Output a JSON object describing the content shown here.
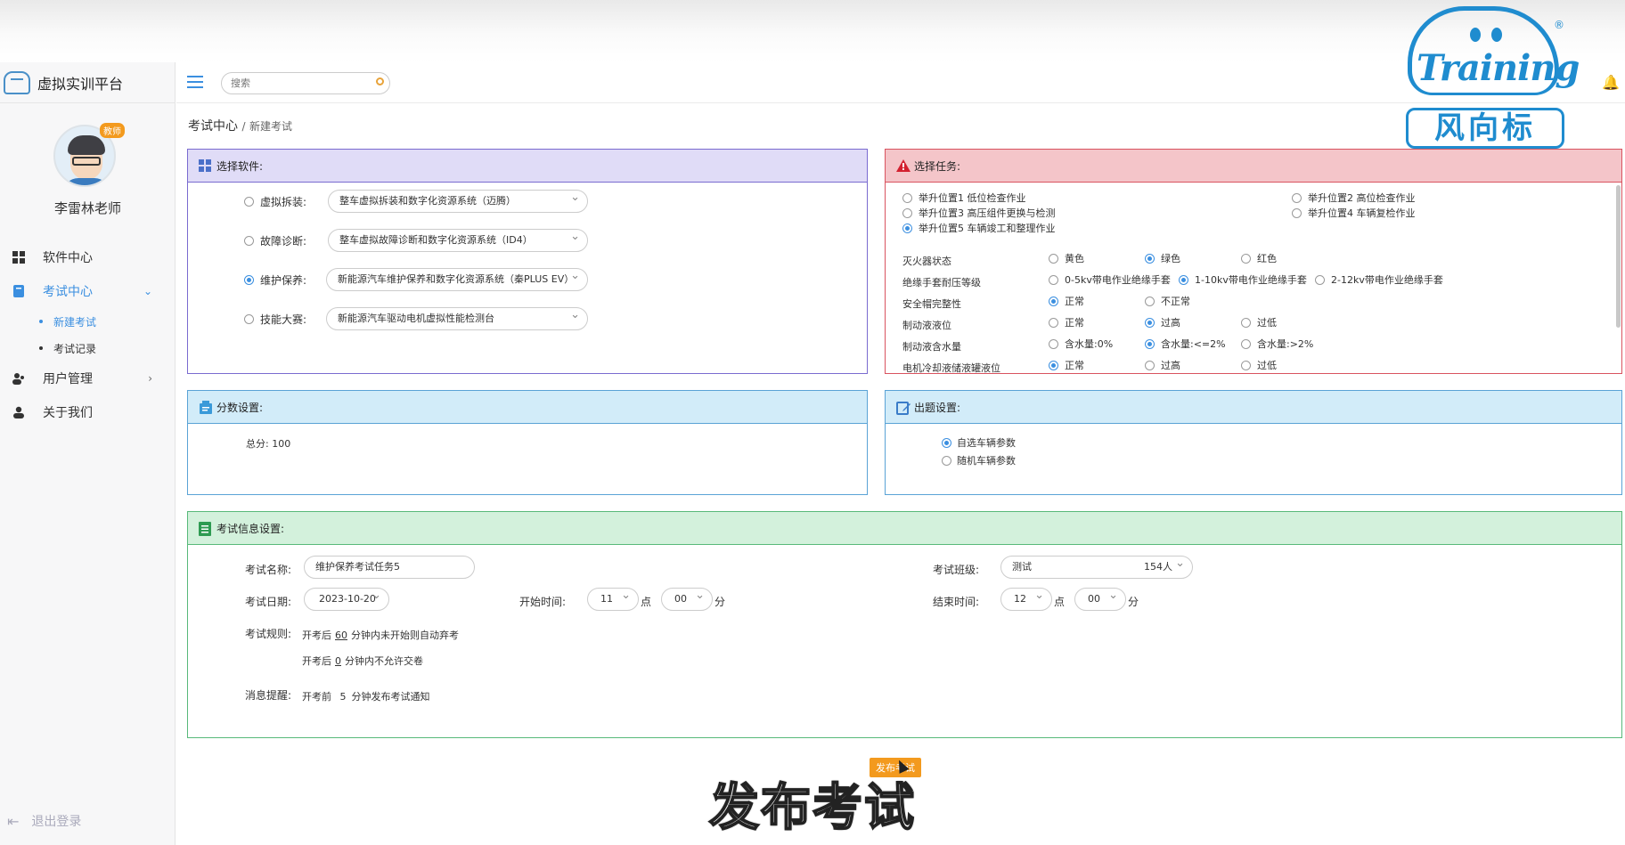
{
  "brand": {
    "title": "虚拟实训平台"
  },
  "user": {
    "name": "李雷林老师",
    "badge": "教师"
  },
  "nav": {
    "items": [
      {
        "label": "软件中心",
        "icon": "grid-icon"
      },
      {
        "label": "考试中心",
        "icon": "book-icon",
        "active": true
      },
      {
        "label": "用户管理",
        "icon": "user-group-icon"
      },
      {
        "label": "关于我们",
        "icon": "users-icon"
      }
    ],
    "sub": [
      {
        "label": "新建考试",
        "active": true
      },
      {
        "label": "考试记录"
      }
    ],
    "logout": "退出登录"
  },
  "search": {
    "placeholder": "搜索"
  },
  "watermark": {
    "word": "Training",
    "cn": "风向标",
    "reg": "®"
  },
  "breadcrumb": {
    "root": "考试中心",
    "sep": "/",
    "current": "新建考试"
  },
  "software": {
    "title": "选择软件:",
    "rows": [
      {
        "label": "虚拟拆装:",
        "value": "整车虚拟拆装和数字化资源系统（迈腾）",
        "checked": false
      },
      {
        "label": "故障诊断:",
        "value": "整车虚拟故障诊断和数字化资源系统（ID4）",
        "checked": false
      },
      {
        "label": "维护保养:",
        "value": "新能源汽车维护保养和数字化资源系统（秦PLUS EV）",
        "checked": true
      },
      {
        "label": "技能大赛:",
        "value": "新能源汽车驱动电机虚拟性能检测台",
        "checked": false
      }
    ]
  },
  "task": {
    "title": "选择任务:",
    "positions": [
      {
        "label": "举升位置1 低位检查作业",
        "checked": false
      },
      {
        "label": "举升位置2 高位检查作业",
        "checked": false
      },
      {
        "label": "举升位置3 高压组件更换与检测",
        "checked": false
      },
      {
        "label": "举升位置4 车辆复检作业",
        "checked": false
      },
      {
        "label": "举升位置5 车辆竣工和整理作业",
        "checked": true
      }
    ],
    "params": [
      {
        "label": "灭火器状态",
        "options": [
          "黄色",
          "绿色",
          "红色"
        ],
        "selected": 1
      },
      {
        "label": "绝缘手套耐压等级",
        "options": [
          "0-5kv带电作业绝缘手套",
          "1-10kv带电作业绝缘手套",
          "2-12kv带电作业绝缘手套"
        ],
        "selected": 1
      },
      {
        "label": "安全帽完整性",
        "options": [
          "正常",
          "不正常"
        ],
        "selected": 0
      },
      {
        "label": "制动液液位",
        "options": [
          "正常",
          "过高",
          "过低"
        ],
        "selected": 1
      },
      {
        "label": "制动液含水量",
        "options": [
          "含水量:0%",
          "含水量:<=2%",
          "含水量:>2%"
        ],
        "selected": 1
      },
      {
        "label": "电机冷却液储液罐液位",
        "options": [
          "正常",
          "过高",
          "过低"
        ],
        "selected": 0
      }
    ]
  },
  "score": {
    "title": "分数设置:",
    "total": "总分: 100"
  },
  "question": {
    "title": "出题设置:",
    "options": [
      "自选车辆参数",
      "随机车辆参数"
    ],
    "selected": 0
  },
  "info": {
    "title": "考试信息设置:",
    "name_label": "考试名称:",
    "name_value": "维护保养考试任务5",
    "class_label": "考试班级:",
    "class_value": "测试",
    "class_count": "154人",
    "date_label": "考试日期:",
    "date_value": "2023-10-20",
    "start_label": "开始时间:",
    "start_hour": "11",
    "start_min": "00",
    "end_label": "结束时间:",
    "end_hour": "12",
    "end_min": "00",
    "hour_unit": "点",
    "min_unit": "分",
    "rules_label": "考试规则:",
    "rule1_pre": "开考后",
    "rule1_val": "60",
    "rule1_post": "分钟内未开始则自动弃考",
    "rule2_pre": "开考后",
    "rule2_val": "0",
    "rule2_post": "分钟内不允许交卷",
    "notify_label": "消息提醒:",
    "notify_pre": "开考前",
    "notify_val": "5",
    "notify_post": "分钟发布考试通知"
  },
  "publish": {
    "label": "发布考试"
  },
  "subtitle": "发布考试",
  "colors": {
    "accent": "#3b8fe0",
    "publish": "#f39a1e",
    "brand": "#1f8ccf"
  }
}
